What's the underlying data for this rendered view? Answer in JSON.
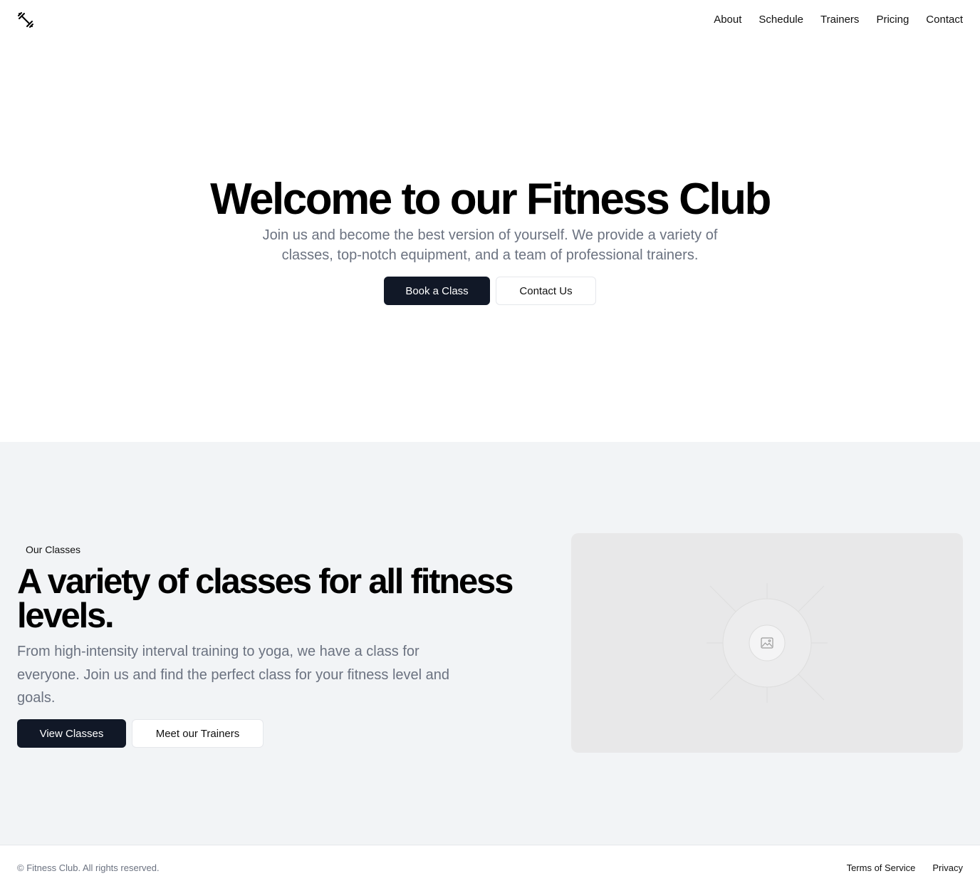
{
  "header": {
    "logo_icon": "dumbbell-icon",
    "nav": [
      {
        "label": "About"
      },
      {
        "label": "Schedule"
      },
      {
        "label": "Trainers"
      },
      {
        "label": "Pricing"
      },
      {
        "label": "Contact"
      }
    ]
  },
  "hero": {
    "title": "Welcome to our Fitness Club",
    "subtitle": "Join us and become the best version of yourself. We provide a variety of classes, top-notch equipment, and a team of professional trainers.",
    "primary_button": "Book a Class",
    "secondary_button": "Contact Us"
  },
  "classes": {
    "badge": "Our Classes",
    "title": "A variety of classes for all fitness levels.",
    "description": "From high-intensity interval training to yoga, we have a class for everyone. Join us and find the perfect class for your fitness level and goals.",
    "primary_button": "View Classes",
    "secondary_button": "Meet our Trainers",
    "image_icon": "image-placeholder-icon"
  },
  "footer": {
    "copyright": "© Fitness Club. All rights reserved.",
    "links": [
      {
        "label": "Terms of Service"
      },
      {
        "label": "Privacy"
      }
    ]
  },
  "colors": {
    "primary_button_bg": "#111827",
    "section_bg": "#f2f4f6",
    "muted_text": "#6b7280"
  }
}
